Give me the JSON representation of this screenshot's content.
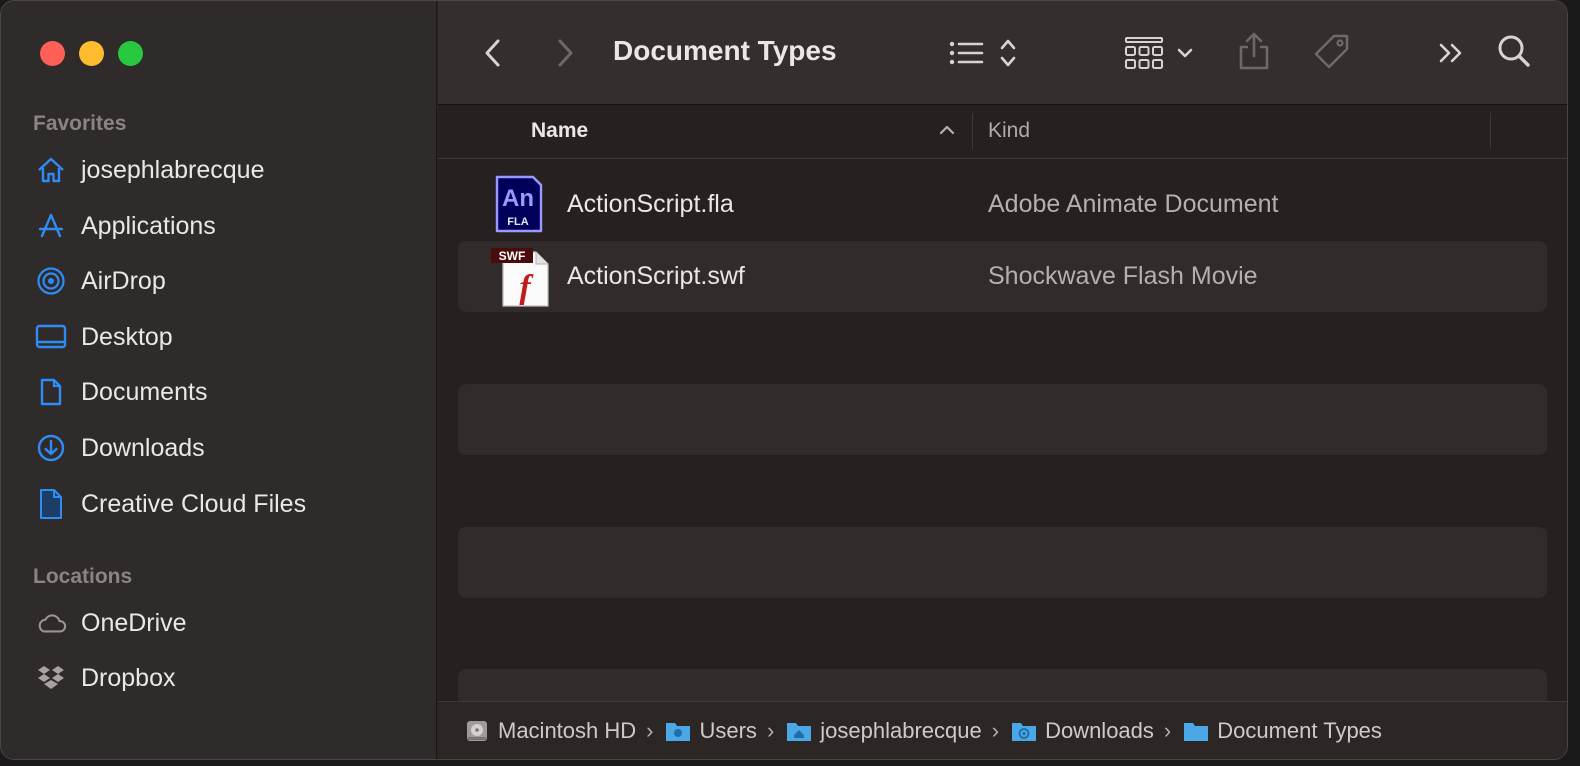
{
  "window": {
    "title": "Document Types"
  },
  "sidebar": {
    "favorites_title": "Favorites",
    "favorites": [
      {
        "label": "josephlabrecque",
        "icon": "home-icon"
      },
      {
        "label": "Applications",
        "icon": "applications-icon"
      },
      {
        "label": "AirDrop",
        "icon": "airdrop-icon"
      },
      {
        "label": "Desktop",
        "icon": "desktop-icon"
      },
      {
        "label": "Documents",
        "icon": "document-icon"
      },
      {
        "label": "Downloads",
        "icon": "downloads-icon"
      },
      {
        "label": "Creative Cloud Files",
        "icon": "file-icon"
      }
    ],
    "locations_title": "Locations",
    "locations": [
      {
        "label": "OneDrive",
        "icon": "cloud-icon"
      },
      {
        "label": "Dropbox",
        "icon": "dropbox-icon"
      }
    ]
  },
  "list": {
    "columns": {
      "name": "Name",
      "kind": "Kind"
    },
    "files": [
      {
        "name": "ActionScript.fla",
        "kind": "Adobe Animate Document",
        "icon_text": "An",
        "icon_sub": "FLA"
      },
      {
        "name": "ActionScript.swf",
        "kind": "Shockwave Flash Movie",
        "icon_text": "SWF",
        "icon_glyph": "f"
      }
    ]
  },
  "pathbar": {
    "crumbs": [
      "Macintosh HD",
      "Users",
      "josephlabrecque",
      "Downloads",
      "Document Types"
    ]
  },
  "colors": {
    "accent": "#2f8cf5",
    "folder": "#4aa8e6",
    "close": "#fe5f57",
    "minimize": "#febc2e",
    "maximize": "#28c840"
  }
}
